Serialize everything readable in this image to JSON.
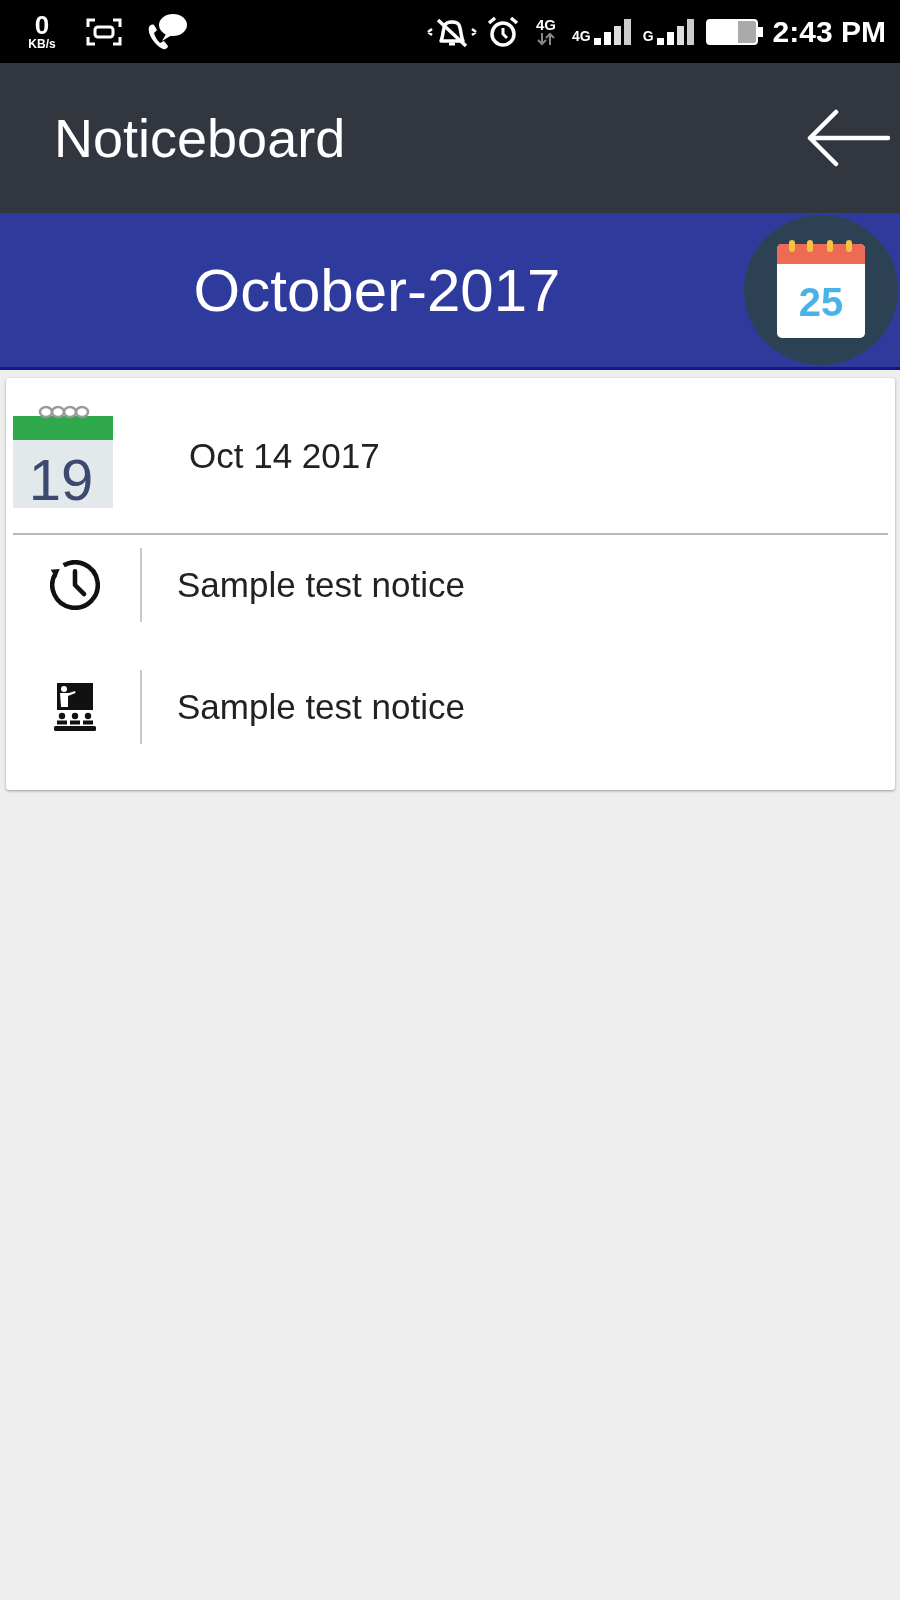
{
  "status_bar": {
    "data_speed": {
      "value": "0",
      "unit": "KB/s"
    },
    "volte_label": "4G",
    "sims": [
      {
        "network": "4G"
      },
      {
        "network": "G"
      }
    ],
    "time": "2:43 PM"
  },
  "app_bar": {
    "title": "Noticeboard"
  },
  "month_bar": {
    "month": "October-2017",
    "calendar_day": "25"
  },
  "notices": [
    {
      "calendar_day": "19",
      "date": "Oct 14 2017",
      "items": [
        {
          "kind": "schedule",
          "text": "Sample test notice"
        },
        {
          "kind": "classroom",
          "text": "Sample test notice"
        }
      ]
    }
  ]
}
